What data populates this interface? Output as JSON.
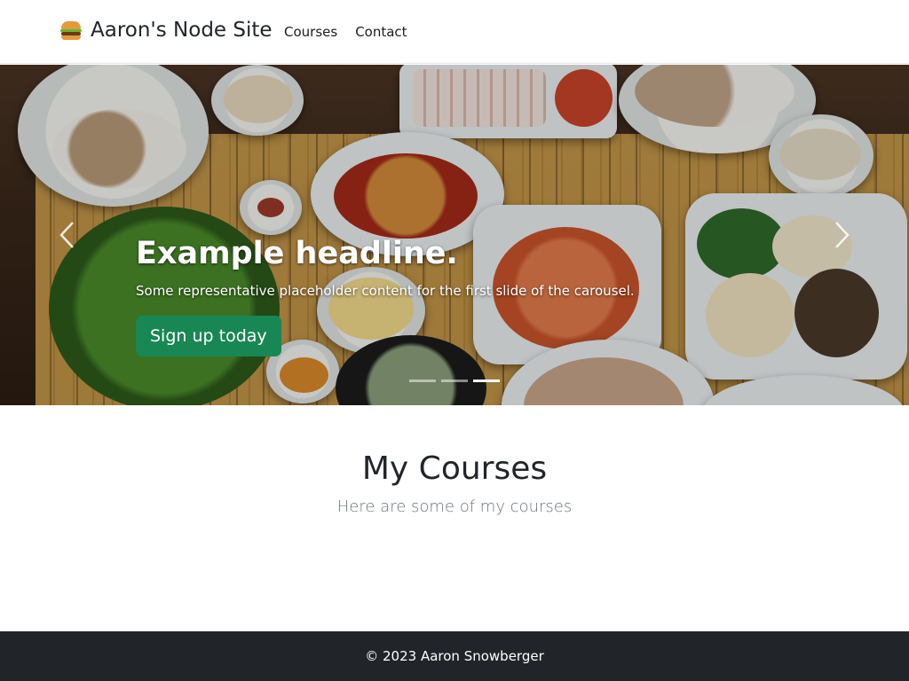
{
  "navbar": {
    "brand_icon": "hamburger-icon",
    "brand_text": "Aaron's Node Site",
    "links": [
      "Courses",
      "Contact"
    ]
  },
  "carousel": {
    "headline": "Example headline.",
    "subtext": "Some representative placeholder content for the first slide of the carousel.",
    "cta_label": "Sign up today",
    "cta_color": "#198754",
    "prev_icon": "chevron-left-icon",
    "next_icon": "chevron-right-icon",
    "indicators": 3,
    "active_indicator": 3
  },
  "courses": {
    "title": "My Courses",
    "subtitle": "Here are some of my courses"
  },
  "footer": {
    "text": "© 2023 Aaron Snowberger",
    "background": "#212529"
  }
}
